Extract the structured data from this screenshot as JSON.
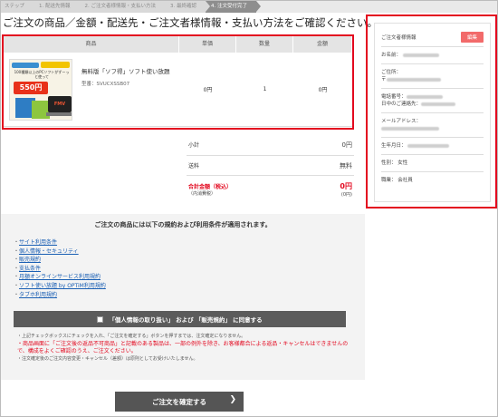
{
  "steps": [
    {
      "label": "ステップ"
    },
    {
      "label": "1. 配送先情報"
    },
    {
      "label": "2. ご注文者様情報・支払い方法"
    },
    {
      "label": "3. 最終確認"
    },
    {
      "label": "4. 注文受付完了"
    }
  ],
  "heading": "ご注文の商品／金額・配送先・ご注文者様情報・支払い方法をご確認ください。",
  "table": {
    "headers": [
      "商品",
      "単価",
      "数量",
      "金額"
    ],
    "row": {
      "name": "無料版「ソフ得」ソフト使い放題",
      "code": "型番：SVUCXSSB07",
      "unit_price": "0円",
      "quantity": "1",
      "amount": "0円"
    },
    "thumb": {
      "banner_text": "100種類以上のPCソフトがずーっと使って",
      "price": "550円",
      "brand": "FMV"
    }
  },
  "totals": {
    "subtotal_label": "小計",
    "subtotal_value": "0円",
    "shipping_label": "送料",
    "shipping_value": "無料",
    "total_label": "合計金額（税込）",
    "total_sub_label": "（内消費税）",
    "total_value": "0円",
    "total_sub_value": "(0円)"
  },
  "customer": {
    "title": "ご注文者様情報",
    "edit": "編集",
    "name_label": "お名前：",
    "address_label": "ご住所：",
    "address_prefix": "〒",
    "phone_label": "電話番号：",
    "daytime_label": "日中のご連絡先：",
    "email_label": "メールアドレス：",
    "birth_label": "生年月日：",
    "gender_label": "性別：",
    "gender_value": "女性",
    "job_label": "職業：",
    "job_value": "会社員"
  },
  "terms": {
    "title": "ご注文の商品には以下の規約および利用条件が適用されます。",
    "links": [
      "サイト利用条件",
      "個人情報・セキュリティ",
      "販売規約",
      "支払条件",
      "月額オンラインサービス利用規約",
      "ソフト使い放題 by OPTiM利用規約",
      "タブホ利用規約"
    ],
    "agree_label": "「個人情報の取り扱い」 および 「販売規約」 に同意する",
    "note1": "・上記チェックボックスにチェックを入れ、「ご注文を確定する」ボタンを押すまでは、注文確定になりません。",
    "note_red": "・商品画面に「ご注文後の返品不可商品」と記載のある製品は、一部の例外を除き、お客様都合による返品・キャンセルはできませんので、構成をよくご確認のうえ、ご注文ください。",
    "note2": "・注文確定後のご注文内容変更・キャンセル（差額）は原則としてお受けいたしません。"
  },
  "confirm_label": "ご注文を確定する",
  "colors": {
    "highlight": "#e3081f",
    "button": "#555555",
    "link": "#1a5fb4"
  }
}
